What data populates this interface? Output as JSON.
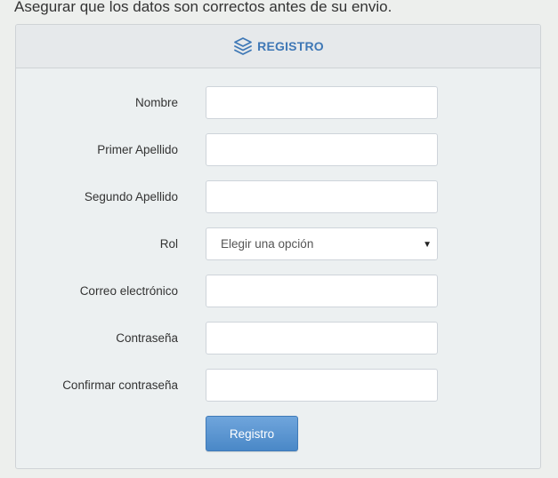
{
  "intro_text": "Asegurar que los datos son correctos antes de su envio.",
  "panel": {
    "title": "REGISTRO",
    "icon": "layers-icon"
  },
  "form": {
    "fields": {
      "nombre": {
        "label": "Nombre",
        "value": ""
      },
      "primer_apellido": {
        "label": "Primer Apellido",
        "value": ""
      },
      "segundo_apellido": {
        "label": "Segundo Apellido",
        "value": ""
      },
      "rol": {
        "label": "Rol",
        "selected": "Elegir una opción"
      },
      "correo": {
        "label": "Correo electrónico",
        "value": ""
      },
      "contrasena": {
        "label": "Contraseña",
        "value": ""
      },
      "confirmar": {
        "label": "Confirmar contraseña",
        "value": ""
      }
    },
    "submit_label": "Registro"
  },
  "colors": {
    "accent": "#3f78b6",
    "button": "#4a88c7",
    "panel_bg": "#ecf0f1"
  }
}
